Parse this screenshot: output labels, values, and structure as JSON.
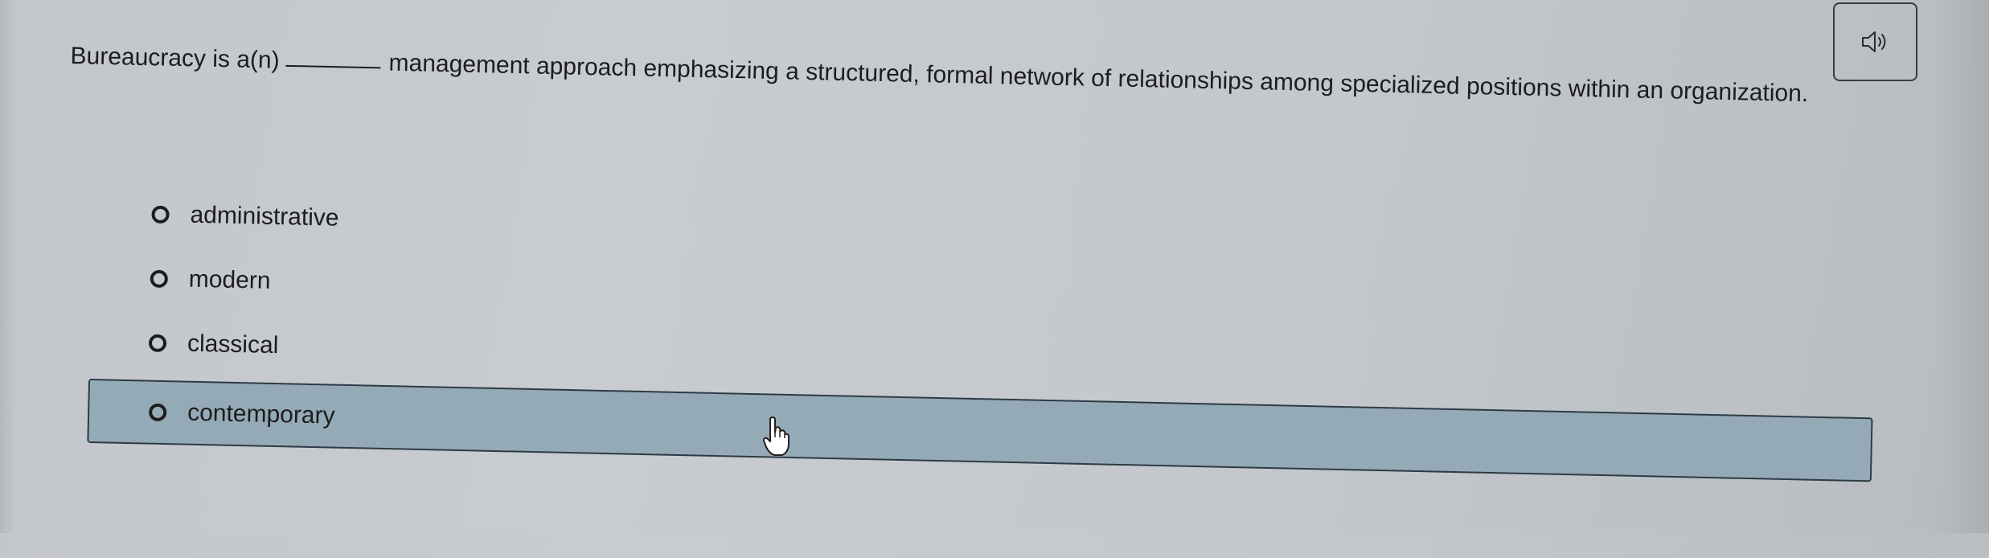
{
  "question": {
    "prefix": "Bureaucracy is a(n)",
    "suffix": "management approach emphasizing a structured, formal network of relationships among specialized positions within an organization."
  },
  "audio": {
    "icon": "speaker-icon"
  },
  "options": [
    {
      "label": "administrative"
    },
    {
      "label": "modern"
    },
    {
      "label": "classical"
    },
    {
      "label": "contemporary"
    }
  ],
  "colors": {
    "background": "#c6cacd",
    "highlight": "#95aab7",
    "text": "#1d1d1d"
  }
}
